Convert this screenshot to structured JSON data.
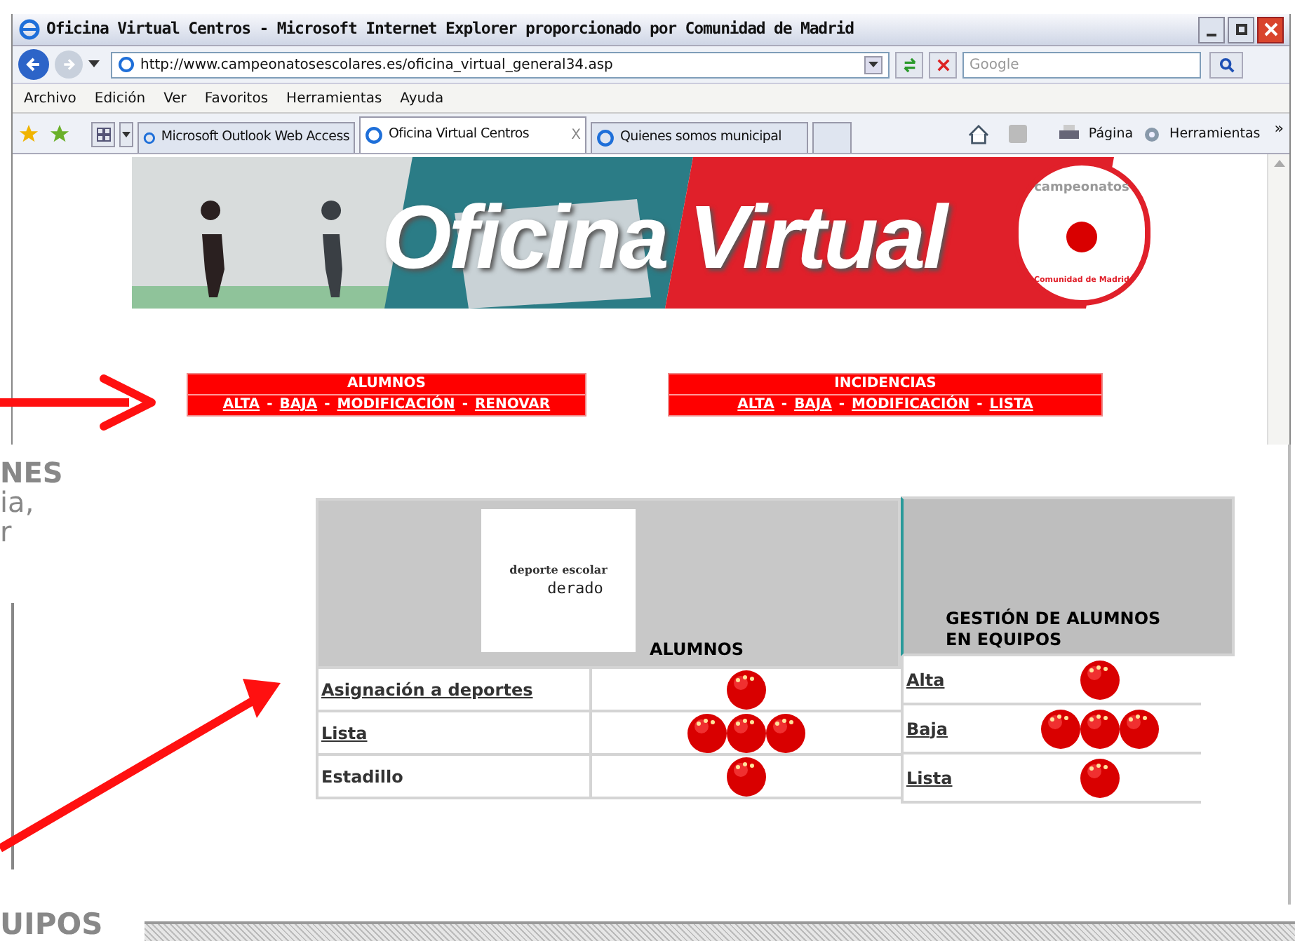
{
  "window": {
    "title": "Oficina Virtual Centros - Microsoft Internet Explorer proporcionado por Comunidad de Madrid"
  },
  "address_bar": {
    "url": "http://www.campeonatosescolares.es/oficina_virtual_general34.asp"
  },
  "search": {
    "placeholder": "Google"
  },
  "menu": [
    "Archivo",
    "Edición",
    "Ver",
    "Favoritos",
    "Herramientas",
    "Ayuda"
  ],
  "tabs": [
    {
      "label": "Microsoft Outlook Web Access",
      "selected": false
    },
    {
      "label": "Oficina Virtual Centros",
      "selected": true
    },
    {
      "label": "Quienes somos municipal",
      "selected": false
    }
  ],
  "tab_close": "X",
  "command_bar": [
    "Página",
    "Herramientas"
  ],
  "command_overflow": "»",
  "page": {
    "banner": {
      "title": "Oficina Virtual",
      "logo_top": "campeonatos",
      "logo_bottom": "Comunidad de Madrid"
    },
    "menus": [
      {
        "title": "ALUMNOS",
        "separator": "-",
        "links": [
          "ALTA",
          "BAJA",
          "MODIFICACIÓN",
          "RENOVAR"
        ]
      },
      {
        "title": "INCIDENCIAS",
        "separator": "-",
        "links": [
          "ALTA",
          "BAJA",
          "MODIFICACIÓN",
          "LISTA"
        ]
      }
    ],
    "tables": [
      {
        "heading": "ALUMNOS",
        "logo": {
          "top": "deporte escolar",
          "middle": "derado"
        },
        "rows": [
          {
            "label": "Asignación a deportes",
            "link": true,
            "icons": [
              {
                "kind": "ball"
              }
            ]
          },
          {
            "label": "Lista",
            "link": true,
            "icons": [
              {
                "kind": "ball"
              },
              {
                "kind": "ball"
              },
              {
                "kind": "ball"
              }
            ]
          },
          {
            "label": "Estadillo",
            "link": false,
            "icons": [
              {
                "kind": "ball"
              }
            ]
          }
        ]
      },
      {
        "heading": "GESTIÓN DE ALUMNOS EN EQUIPOS",
        "rows": [
          {
            "label": "Alta",
            "link": true,
            "icons": [
              {
                "kind": "ball"
              }
            ]
          },
          {
            "label": "Baja",
            "link": true,
            "icons": [
              {
                "kind": "ball"
              },
              {
                "kind": "ball"
              },
              {
                "kind": "ball"
              }
            ]
          },
          {
            "label": "Lista",
            "link": true,
            "icons": [
              {
                "kind": "ball"
              }
            ]
          }
        ]
      }
    ]
  },
  "slide": {
    "fragments": [
      {
        "text": "NES",
        "bold": true
      },
      {
        "text": "ia,",
        "bold": false
      },
      {
        "text": "r",
        "bold": false
      }
    ],
    "footer": "UIPOS"
  }
}
